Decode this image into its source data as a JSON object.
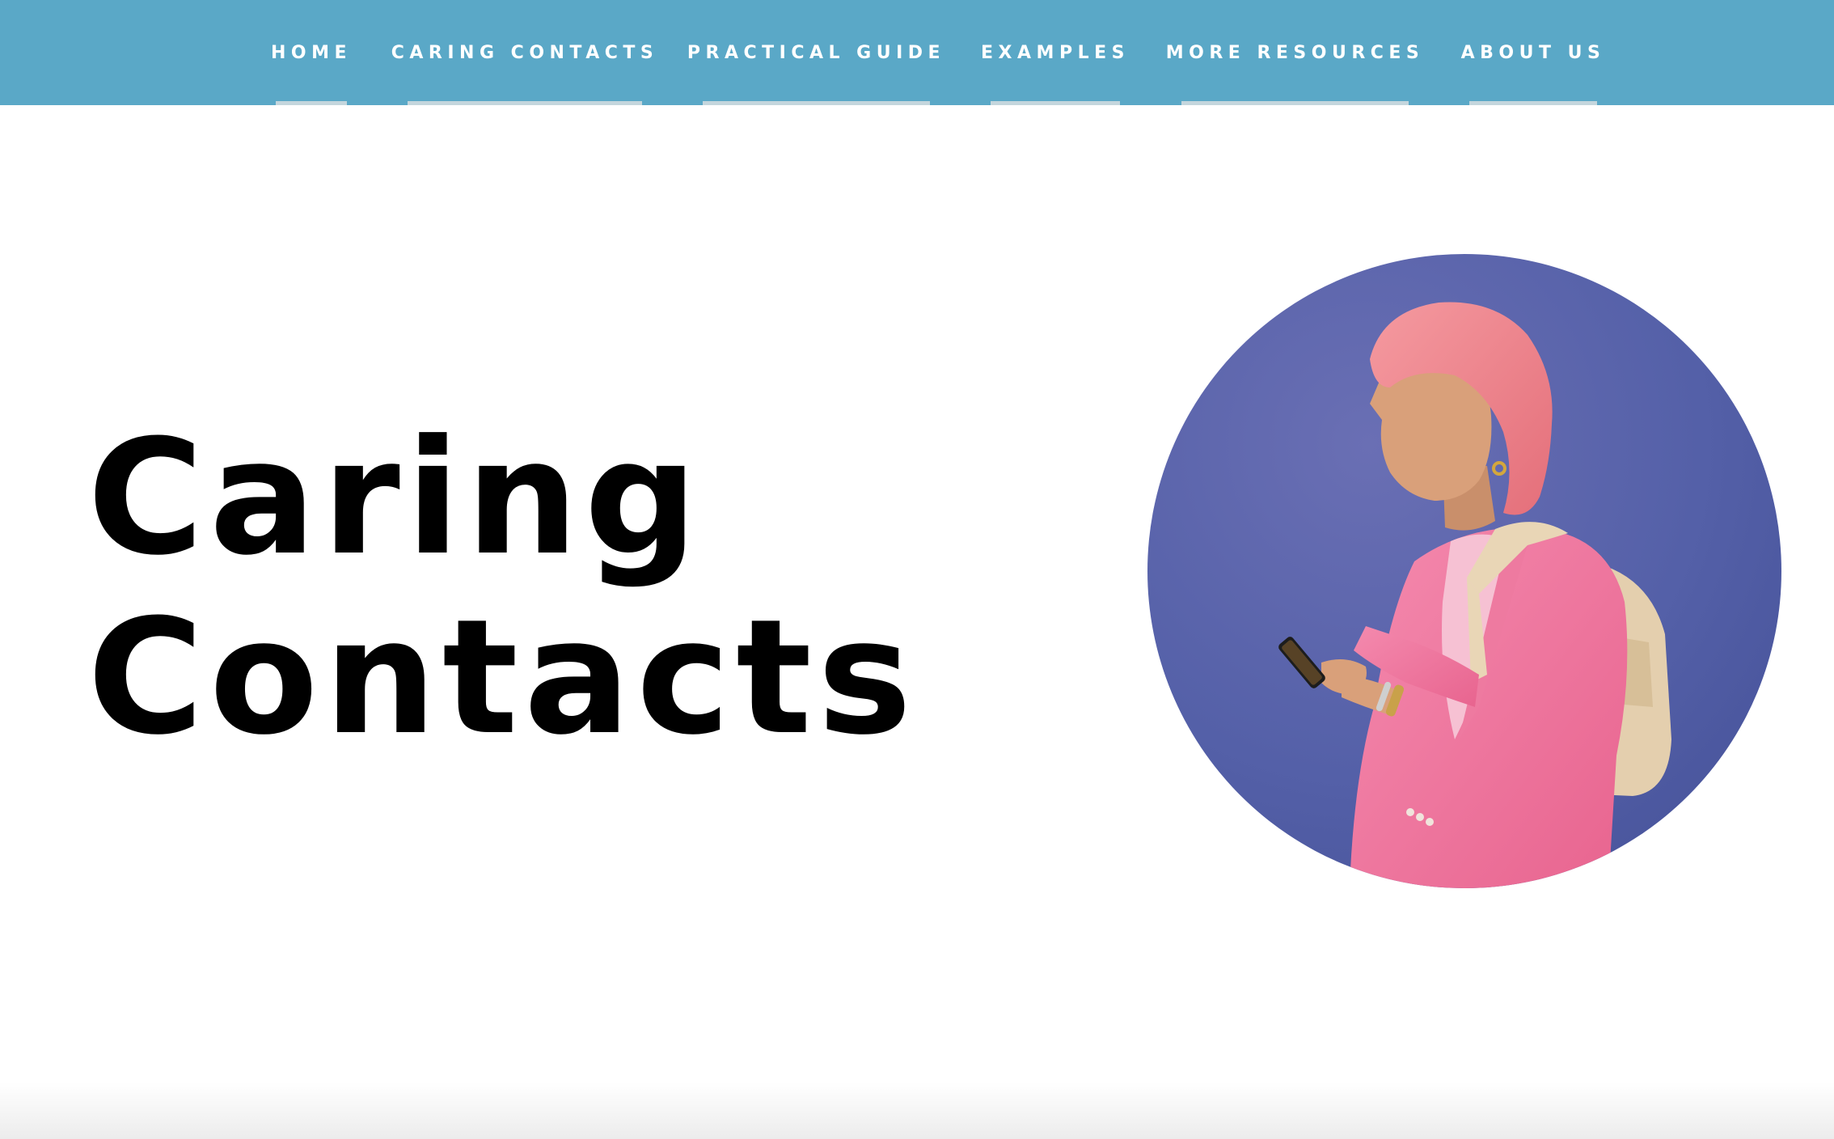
{
  "nav": {
    "items": [
      {
        "label": "HOME"
      },
      {
        "label": "CARING CONTACTS"
      },
      {
        "label": "PRACTICAL GUIDE"
      },
      {
        "label": "EXAMPLES"
      },
      {
        "label": "MORE RESOURCES"
      },
      {
        "label": "ABOUT US"
      }
    ]
  },
  "hero": {
    "title_line1": "Caring",
    "title_line2": "Contacts",
    "photo": {
      "subject": "person-with-pink-hair-using-phone",
      "colors": {
        "background": "#5460a8",
        "jacket": "#f07aa0",
        "hair": "#f0848e",
        "backpack": "#e4cfae"
      }
    }
  },
  "colors": {
    "nav_background": "#5aa8c7",
    "nav_text": "#ffffff",
    "nav_underline": "#c4d6dd",
    "page_background": "#ffffff",
    "title_text": "#000000"
  }
}
